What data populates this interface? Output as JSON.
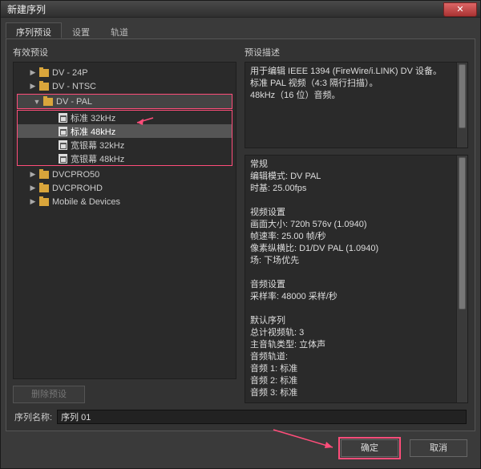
{
  "window": {
    "title": "新建序列",
    "close_glyph": "✕"
  },
  "tabs": [
    {
      "label": "序列预设",
      "active": true
    },
    {
      "label": "设置",
      "active": false
    },
    {
      "label": "轨道",
      "active": false
    }
  ],
  "left": {
    "group_label": "有效预设",
    "tree": [
      {
        "kind": "folder",
        "label": "DV - 24P",
        "depth": 1,
        "expanded": false
      },
      {
        "kind": "folder",
        "label": "DV - NTSC",
        "depth": 1,
        "expanded": false
      },
      {
        "kind": "folder",
        "label": "DV - PAL",
        "depth": 1,
        "expanded": true,
        "highlight": true
      },
      {
        "kind": "preset",
        "label": "标准 32kHz",
        "depth": 2
      },
      {
        "kind": "preset",
        "label": "标准 48kHz",
        "depth": 2,
        "selected": true,
        "highlight": true
      },
      {
        "kind": "preset",
        "label": "宽银幕 32kHz",
        "depth": 2
      },
      {
        "kind": "preset",
        "label": "宽银幕 48kHz",
        "depth": 2
      },
      {
        "kind": "folder",
        "label": "DVCPRO50",
        "depth": 1,
        "expanded": false
      },
      {
        "kind": "folder",
        "label": "DVCPROHD",
        "depth": 1,
        "expanded": false
      },
      {
        "kind": "folder",
        "label": "Mobile & Devices",
        "depth": 1,
        "expanded": false
      }
    ],
    "delete_label": "删除预设"
  },
  "right": {
    "group_label": "预设描述",
    "summary_lines": [
      "用于编辑 IEEE 1394 (FireWire/i.LINK) DV 设备。",
      "标准 PAL 视频（4:3 隔行扫描）。",
      "48kHz（16 位）音频。"
    ],
    "detail_lines": [
      "常规",
      "编辑模式: DV PAL",
      "时基: 25.00fps",
      "",
      "视频设置",
      "画面大小: 720h 576v (1.0940)",
      "帧速率: 25.00 帧/秒",
      "像素纵横比: D1/DV PAL (1.0940)",
      "场: 下场优先",
      "",
      "音频设置",
      "采样率: 48000 采样/秒",
      "",
      "默认序列",
      "总计视频轨: 3",
      "主音轨类型: 立体声",
      "音频轨道:",
      "音频 1: 标准",
      "音频 2: 标准",
      "音频 3: 标准"
    ]
  },
  "sequence_name": {
    "label": "序列名称:",
    "value": "序列 01"
  },
  "footer": {
    "ok": "确定",
    "cancel": "取消"
  }
}
